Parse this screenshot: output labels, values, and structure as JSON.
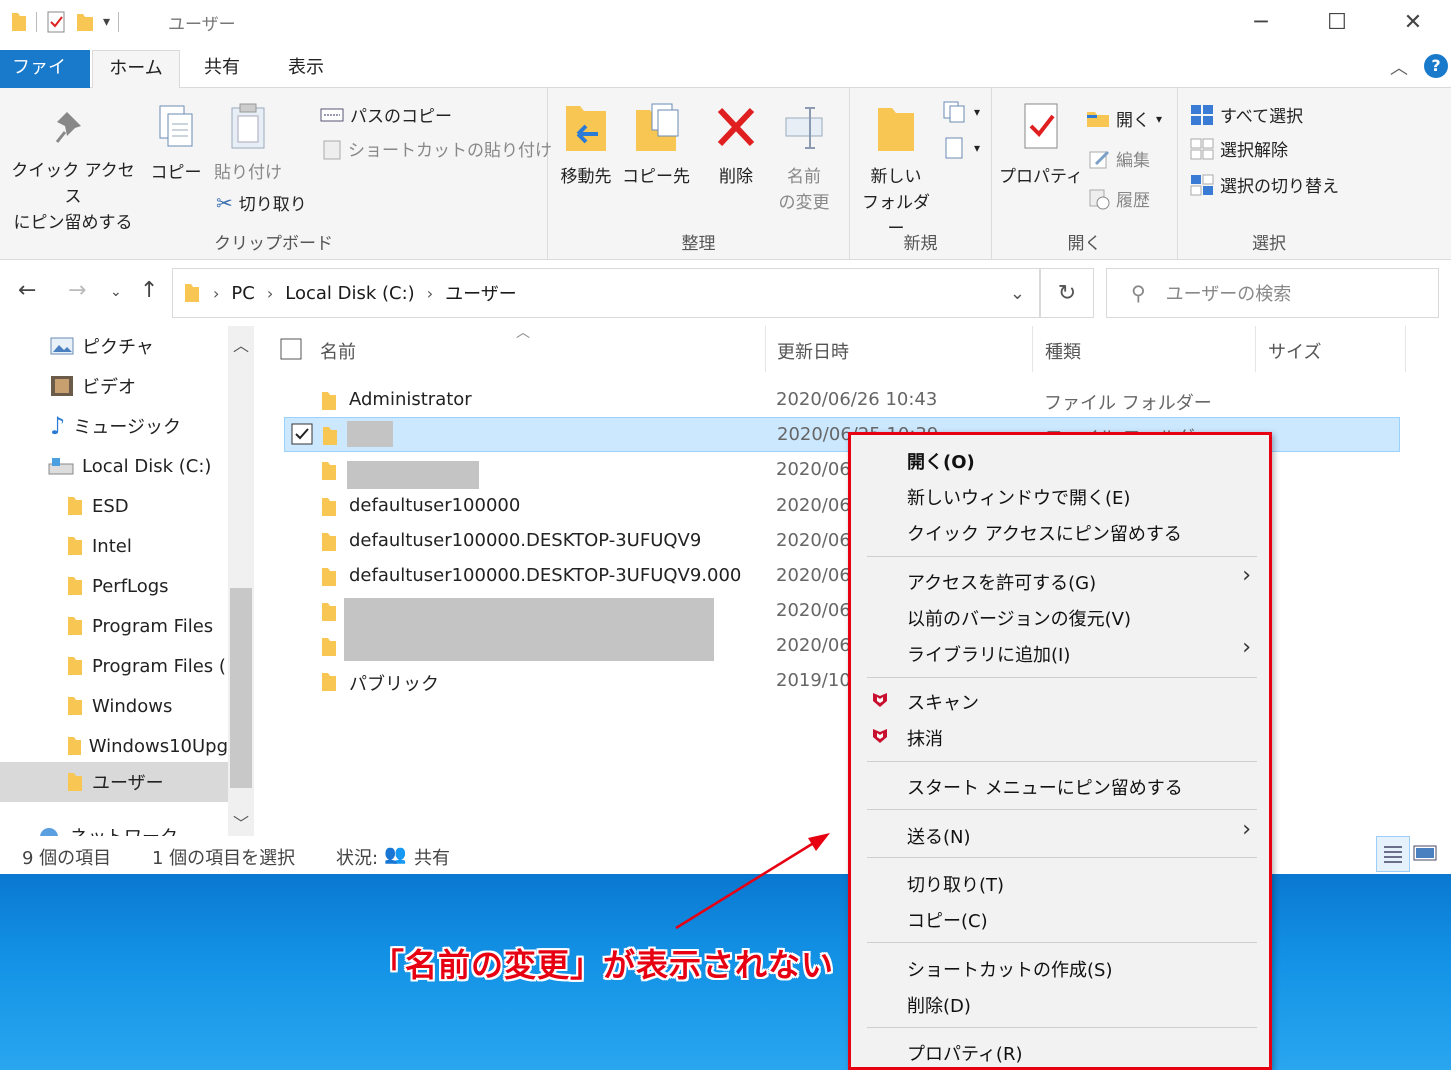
{
  "window": {
    "title": "ユーザー",
    "tabs": {
      "file": "ファイル",
      "home": "ホーム",
      "share": "共有",
      "view": "表示"
    }
  },
  "ribbon": {
    "clipboard": {
      "label": "クリップボード",
      "pin_line1": "クイック アクセス",
      "pin_line2": "にピン留めする",
      "copy": "コピー",
      "paste": "貼り付け",
      "copy_path": "パスのコピー",
      "paste_shortcut": "ショートカットの貼り付け",
      "cut": "切り取り"
    },
    "organize": {
      "label": "整理",
      "move_to": "移動先",
      "copy_to": "コピー先",
      "delete": "削除",
      "rename_line1": "名前",
      "rename_line2": "の変更"
    },
    "new": {
      "label": "新規",
      "new_folder_line1": "新しい",
      "new_folder_line2": "フォルダー"
    },
    "open": {
      "label": "開く",
      "properties": "プロパティ",
      "open": "開く",
      "edit": "編集",
      "history": "履歴"
    },
    "select": {
      "label": "選択",
      "select_all": "すべて選択",
      "select_none": "選択解除",
      "invert": "選択の切り替え"
    }
  },
  "address": {
    "crumbs": [
      "PC",
      "Local Disk (C:)",
      "ユーザー"
    ],
    "search_placeholder": "ユーザーの検索"
  },
  "nav_pane": {
    "items": [
      "ピクチャ",
      "ビデオ",
      "ミュージック",
      "Local Disk (C:)",
      "ESD",
      "Intel",
      "PerfLogs",
      "Program Files",
      "Program Files (",
      "Windows",
      "Windows10Upg",
      "ユーザー",
      "ネットワーク"
    ]
  },
  "file_list": {
    "columns": {
      "name": "名前",
      "modified": "更新日時",
      "type": "種類",
      "size": "サイズ"
    },
    "rows": [
      {
        "name": "Administrator",
        "date": "2020/06/26 10:43",
        "type": "ファイル フォルダー"
      },
      {
        "name": "",
        "date": "2020/06/25 10:39",
        "type": "ファイル フォルダー"
      },
      {
        "name": "",
        "date": "2020/06",
        "type": ""
      },
      {
        "name": "defaultuser100000",
        "date": "2020/06",
        "type": ""
      },
      {
        "name": "defaultuser100000.DESKTOP-3UFUQV9",
        "date": "2020/06",
        "type": ""
      },
      {
        "name": "defaultuser100000.DESKTOP-3UFUQV9.000",
        "date": "2020/06",
        "type": ""
      },
      {
        "name": "",
        "date": "2020/06",
        "type": ""
      },
      {
        "name": "",
        "date": "2020/06",
        "type": ""
      },
      {
        "name": "パブリック",
        "date": "2019/10",
        "type": ""
      }
    ]
  },
  "status": {
    "count": "9 個の項目",
    "selected": "1 個の項目を選択",
    "state_label": "状況:",
    "state_value": "共有"
  },
  "context_menu": {
    "items": {
      "open": "開く(O)",
      "open_new_window": "新しいウィンドウで開く(E)",
      "pin_quick_access": "クイック アクセスにピン留めする",
      "give_access": "アクセスを許可する(G)",
      "restore_versions": "以前のバージョンの復元(V)",
      "add_to_library": "ライブラリに追加(I)",
      "scan": "スキャン",
      "shred": "抹消",
      "pin_start": "スタート メニューにピン留めする",
      "send_to": "送る(N)",
      "cut": "切り取り(T)",
      "copy": "コピー(C)",
      "create_shortcut": "ショートカットの作成(S)",
      "delete": "削除(D)",
      "properties": "プロパティ(R)"
    }
  },
  "annotation": {
    "text": "「名前の変更」が表示されない",
    "color": "#e60012"
  },
  "colors": {
    "accent": "#1979ca",
    "selection": "#cce8ff",
    "folder": "#f8c652",
    "highlight_border": "#e60012",
    "desktop": "#0a78d0"
  }
}
